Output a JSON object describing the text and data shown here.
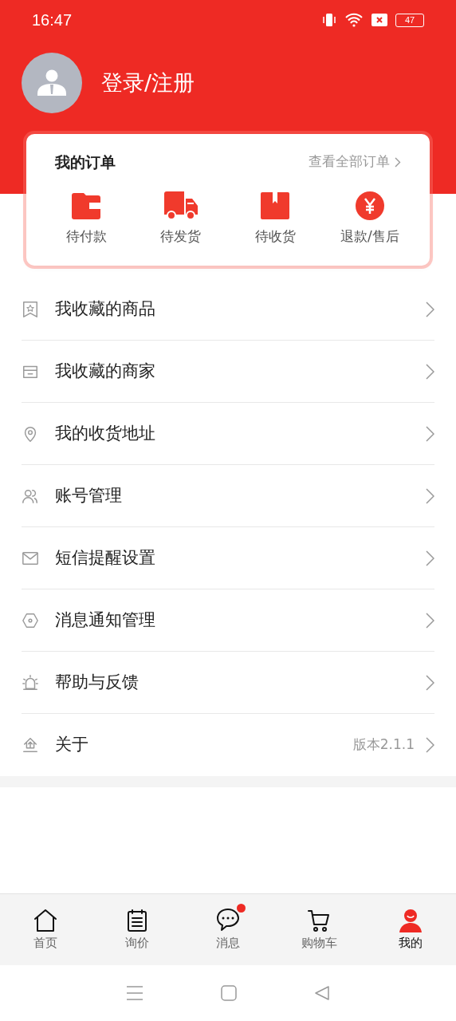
{
  "status_bar": {
    "time": "16:47",
    "battery": "47"
  },
  "profile": {
    "login": "登录/注册"
  },
  "orders": {
    "title": "我的订单",
    "view_all": "查看全部订单",
    "items": [
      {
        "label": "待付款"
      },
      {
        "label": "待发货"
      },
      {
        "label": "待收货"
      },
      {
        "label": "退款/售后"
      }
    ]
  },
  "menu": [
    {
      "label": "我收藏的商品"
    },
    {
      "label": "我收藏的商家"
    },
    {
      "label": "我的收货地址"
    },
    {
      "label": "账号管理"
    },
    {
      "label": "短信提醒设置"
    },
    {
      "label": "消息通知管理"
    },
    {
      "label": "帮助与反馈"
    },
    {
      "label": "关于",
      "detail": "版本2.1.1"
    }
  ],
  "tabs": [
    {
      "label": "首页",
      "selected": false,
      "badge": false
    },
    {
      "label": "询价",
      "selected": false,
      "badge": false
    },
    {
      "label": "消息",
      "selected": false,
      "badge": true
    },
    {
      "label": "购物车",
      "selected": false,
      "badge": false
    },
    {
      "label": "我的",
      "selected": true,
      "badge": false
    }
  ]
}
